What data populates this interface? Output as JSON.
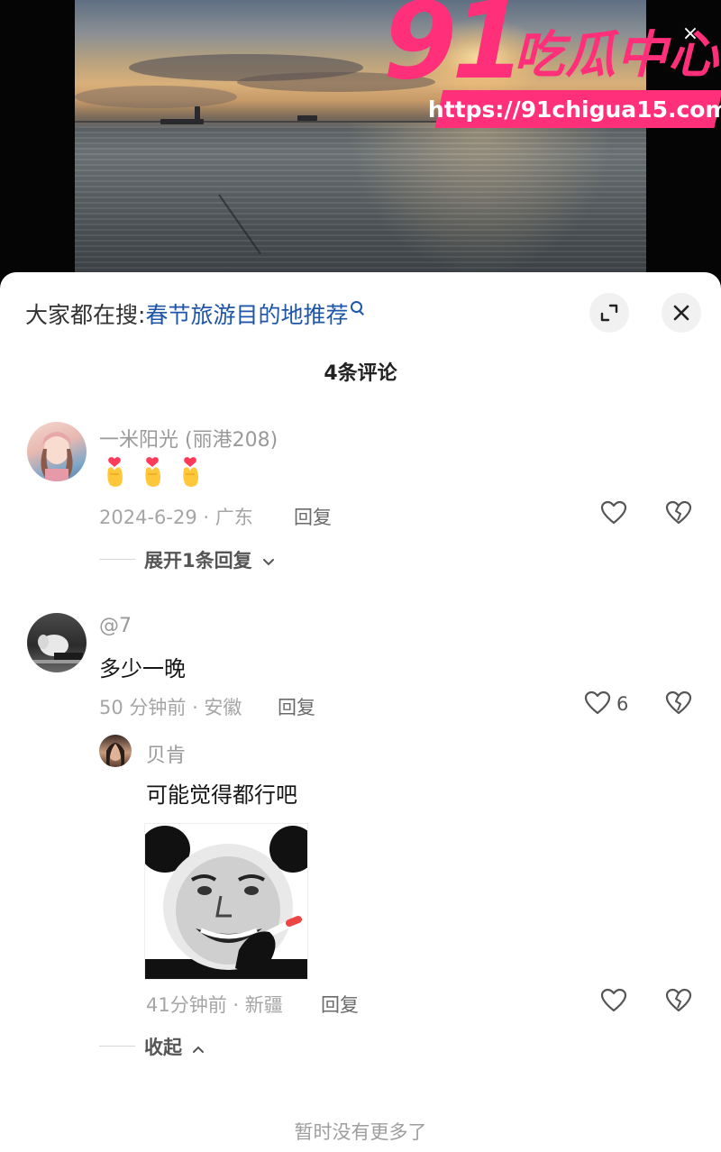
{
  "watermark": {
    "number": "91",
    "name": "吃瓜中心",
    "url": "https://91chigua15.com",
    "close_symbol": "×"
  },
  "sheet": {
    "search": {
      "prefix": "大家都在搜:",
      "term": "春节旅游目的地推荐"
    },
    "comment_count": "4条评论",
    "comments": [
      {
        "name": "一米阳光 (丽港208)",
        "text": "",
        "emoji": [
          "finger-heart",
          "finger-heart",
          "finger-heart"
        ],
        "meta": "2024-6-29 · 广东",
        "reply_label": "回复",
        "like_count": "",
        "expand_label": "展开1条回复"
      },
      {
        "name": "@7",
        "text": "多少一晚",
        "meta": "50 分钟前 · 安徽",
        "reply_label": "回复",
        "like_count": "6",
        "replies": [
          {
            "name": "贝肯",
            "text": "可能觉得都行吧",
            "has_sticker": true,
            "meta": "41分钟前 · 新疆",
            "reply_label": "回复"
          }
        ],
        "collapse_label": "收起"
      }
    ],
    "footer": "暂时没有更多了"
  },
  "colors": {
    "link_blue": "#1f56a8",
    "watermark_pink": "#ff2f7a"
  }
}
